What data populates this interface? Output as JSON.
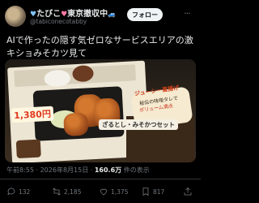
{
  "tweet": {
    "author_name_parts": [
      "たびこ",
      "東京撤収中"
    ],
    "author_emoji": [
      "♥",
      "♥",
      "🚙"
    ],
    "handle": "@tabiconecotabby",
    "follow_label": "フォロー",
    "more_label": "···",
    "text": "AIで作ったの隠す気ゼロなサービスエリアの激キショみそカツ見て",
    "timestamp": "午前8:55 · 2026年8月15日 · ",
    "views": "160.6万",
    "views_suffix": " 件の表示"
  },
  "photo": {
    "price": "1,380円",
    "banner_title": "ジューシー直揚げ",
    "banner_line1": "秘伝の味噌タレで",
    "banner_line2": "ボリューム満点",
    "set_label": "ざるとし・みそかつセット"
  },
  "actions": {
    "replies": "132",
    "retweets": "2,185",
    "likes": "1,375",
    "bookmarks": "817"
  },
  "colors": {
    "background": "#000000",
    "text": "#e7e9ea",
    "muted": "#71767b",
    "follow_bg": "#eff3f4"
  }
}
